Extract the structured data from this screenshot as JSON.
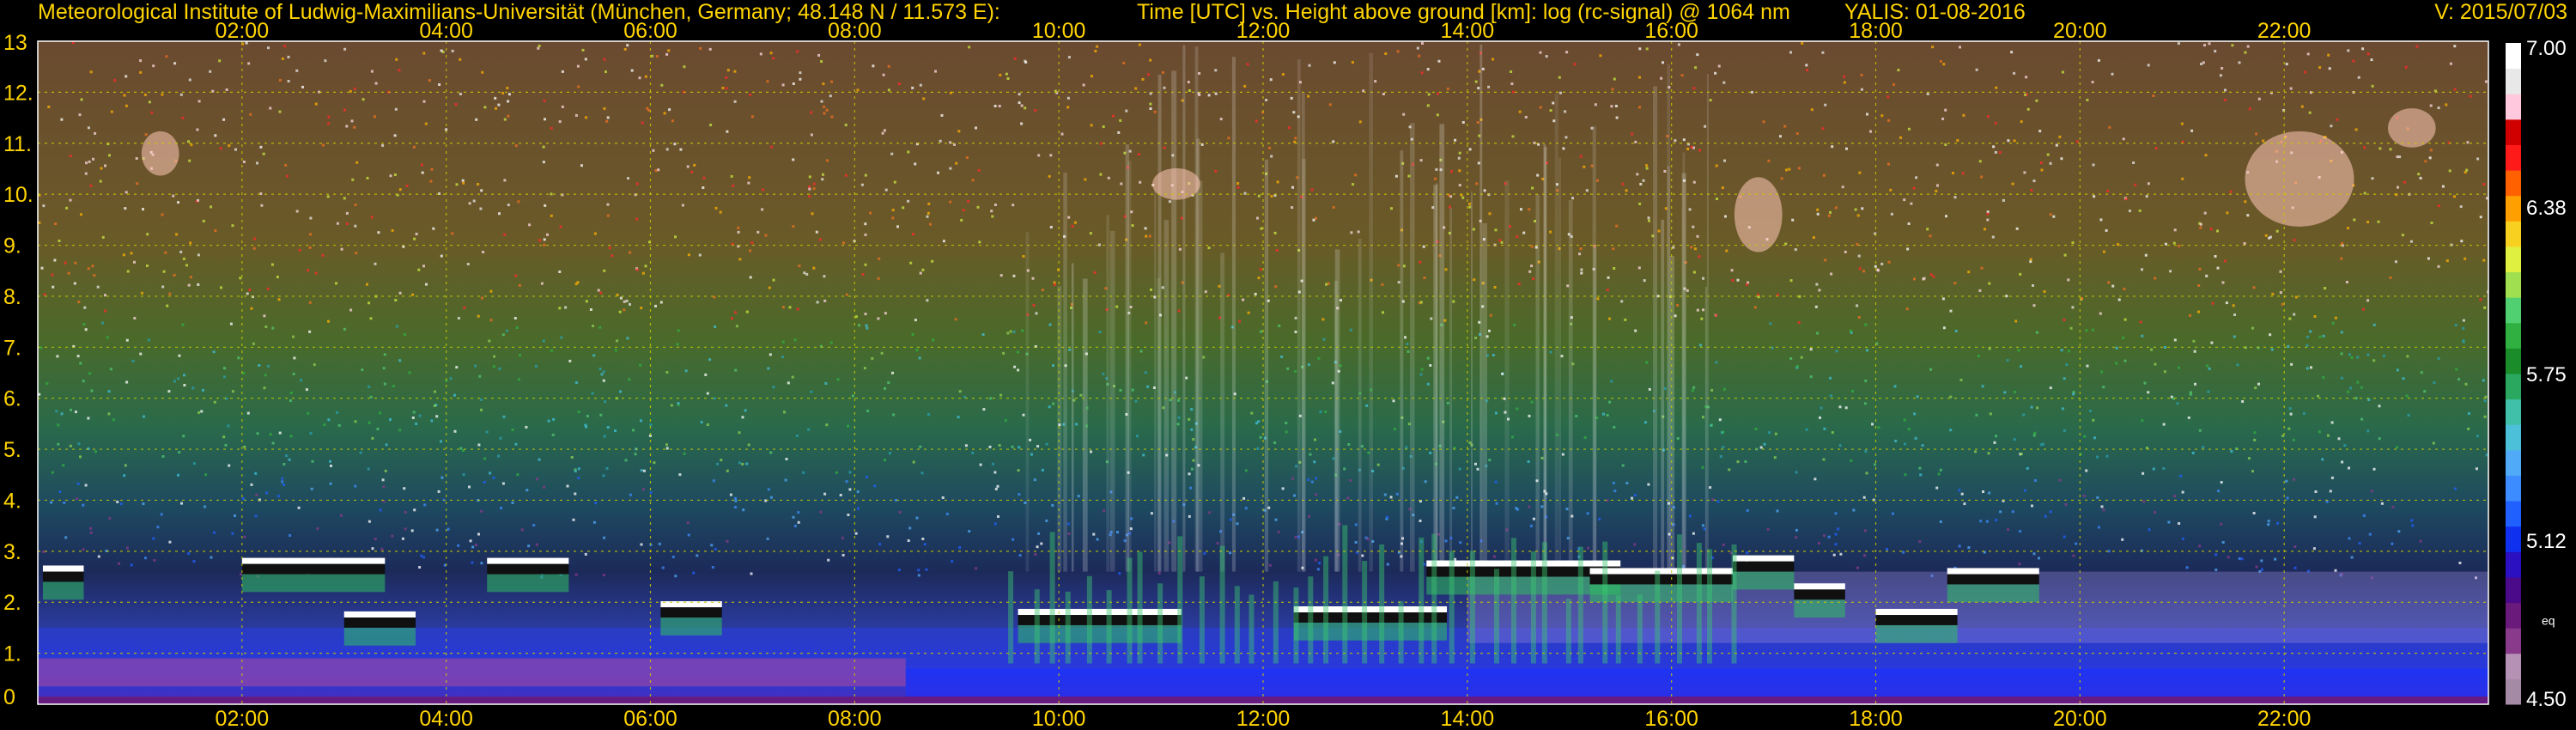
{
  "header": {
    "institute": "Meteorological Institute of Ludwig-Maximilians-Universität (München, Germany; 48.148 N / 11.573 E):",
    "title": "Time [UTC] vs. Height above ground [km]: log (rc-signal) @ 1064 nm",
    "instrument": "YALIS: 01-08-2016",
    "version": "V: 2015/07/03"
  },
  "chart_data": {
    "type": "heatmap",
    "title": "Time [UTC] vs. Height above ground [km]: log (rc-signal) @ 1064 nm",
    "xlabel": "Time [UTC]",
    "ylabel": "Height above ground [km]",
    "x_ticks": [
      "02:00",
      "04:00",
      "06:00",
      "08:00",
      "10:00",
      "12:00",
      "14:00",
      "16:00",
      "18:00",
      "20:00",
      "22:00"
    ],
    "x_tick_hours": [
      2,
      4,
      6,
      8,
      10,
      12,
      14,
      16,
      18,
      20,
      22
    ],
    "xlim": [
      0,
      24
    ],
    "y_ticks": [
      "0",
      "1.",
      "2.",
      "3.",
      "4.",
      "5.",
      "6.",
      "7.",
      "8.",
      "9.",
      "10.",
      "11.",
      "12.",
      "13"
    ],
    "y_tick_values": [
      0,
      1,
      2,
      3,
      4,
      5,
      6,
      7,
      8,
      9,
      10,
      11,
      12,
      13
    ],
    "ylim": [
      0,
      13
    ],
    "grid": true,
    "colorbar": {
      "range": [
        4.5,
        7.0
      ],
      "tick_labels": [
        "7.00",
        "6.38",
        "5.75",
        "5.12",
        "4.50"
      ],
      "tick_values": [
        7.0,
        6.38,
        5.75,
        5.12,
        4.5
      ],
      "extra_label": "eq",
      "colors": [
        "#a58aa5",
        "#b592b5",
        "#8a3a8a",
        "#6a1a7a",
        "#4a0a8a",
        "#2a10c0",
        "#1030f0",
        "#2060ff",
        "#3c8cff",
        "#50aaf8",
        "#4cc0d8",
        "#40c0a8",
        "#2aa860",
        "#1a8c2a",
        "#30b040",
        "#50d070",
        "#a0e050",
        "#e0f040",
        "#f8d020",
        "#ffa000",
        "#ff6000",
        "#ff1a1a",
        "#d00000",
        "#ffc8dc",
        "#e8e8e8",
        "#ffffff"
      ]
    },
    "features": {
      "cloud_tops_km": [
        2.7,
        2.85,
        2.5,
        1.8,
        1.6
      ],
      "cirrus_km": [
        9,
        12
      ]
    }
  }
}
